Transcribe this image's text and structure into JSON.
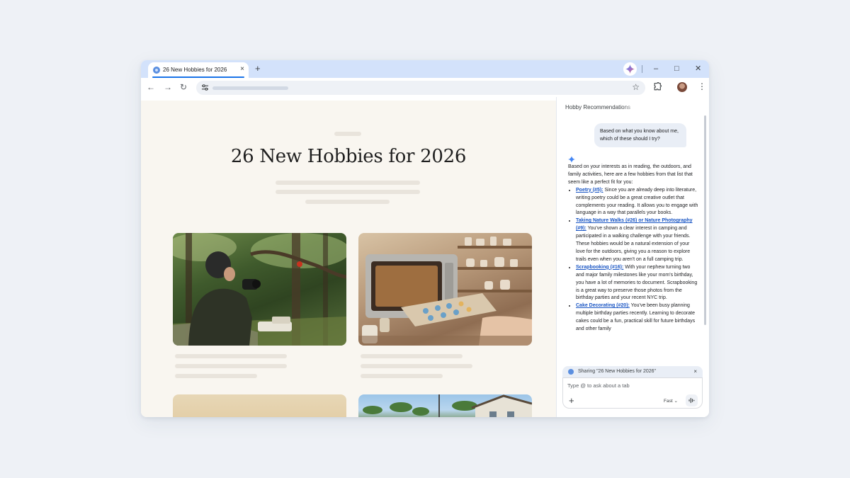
{
  "browser": {
    "tab_title": "26 New Hobbies for 2026",
    "tab_close": "×",
    "new_tab": "+",
    "window_controls": {
      "minimize": "–",
      "maximize": "□",
      "close": "✕"
    },
    "nav": {
      "back": "←",
      "forward": "→",
      "reload": "↻"
    },
    "bookmark_star": "☆",
    "menu": "⋮"
  },
  "page": {
    "title": "26 New Hobbies for 2026"
  },
  "panel": {
    "title": "Hobby Recommendations",
    "user_message": "Based on what you know about me, which of these should I try?",
    "response_intro": "Based on your interests as in reading, the outdoors, and family activities, here are a few hobbies from that list that seem like a perfect fit for you:",
    "items": [
      {
        "link": "Poetry (#5):",
        "text": " Since you are already deep into literature, writing poetry could be a great creative outlet that complements your reading. It allows you to engage with language in a way that parallels your books."
      },
      {
        "link": "Taking Nature Walks (#26) or Nature Photography (#9):",
        "text": " You've shown a clear interest in camping and participated in a walking challenge with your friends. These hobbies would be a natural extension of your love for the outdoors, giving you a reason to explore trails even when you aren't on a full camping trip."
      },
      {
        "link": "Scrapbooking (#16):",
        "text": " With your nephew turning two and major family milestones like your mom's birthday, you have a lot of memories to document. Scrapbooking is a great way to preserve those photos from the birthday parties and your recent NYC trip."
      },
      {
        "link": "Cake Decorating (#20):",
        "text": " You've been busy planning multiple birthday parties recently. Learning to decorate cakes could be a fun, practical skill for future birthdays and other family"
      }
    ],
    "sharing_label": "Sharing \"26 New Hobbies for 2026\"",
    "sharing_close": "×",
    "input_placeholder": "Type @ to ask about a tab",
    "add": "+",
    "mode": "Fast ⌄"
  },
  "icons": {
    "favicon": "globe-icon",
    "gemini": "gemini-sparkle-icon",
    "tune": "site-settings-icon",
    "extensions": "puzzle-icon",
    "mic": "audio-waveform-icon"
  },
  "colors": {
    "accent": "#1a73e8",
    "link": "#1a56c4",
    "tab_strip": "#d3e2fb",
    "page_bg": "#f9f6f0",
    "desktop_bg": "#eef1f6"
  }
}
